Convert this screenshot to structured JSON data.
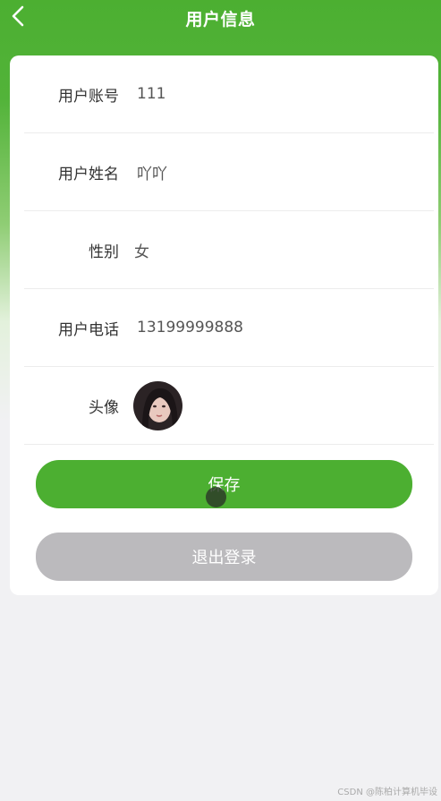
{
  "header": {
    "title": "用户信息",
    "back_icon": "chevron-left-icon"
  },
  "form": {
    "fields": [
      {
        "label": "用户账号",
        "value": "111"
      },
      {
        "label": "用户姓名",
        "value": "吖吖"
      },
      {
        "label": "性别",
        "value": "女"
      },
      {
        "label": "用户电话",
        "value": "13199999888"
      }
    ],
    "avatar_label": "头像"
  },
  "buttons": {
    "save": "保存",
    "logout": "退出登录"
  },
  "watermark": "CSDN @陈柏计算机毕设",
  "colors": {
    "primary": "#4caf31",
    "logout": "#bbbabd"
  }
}
